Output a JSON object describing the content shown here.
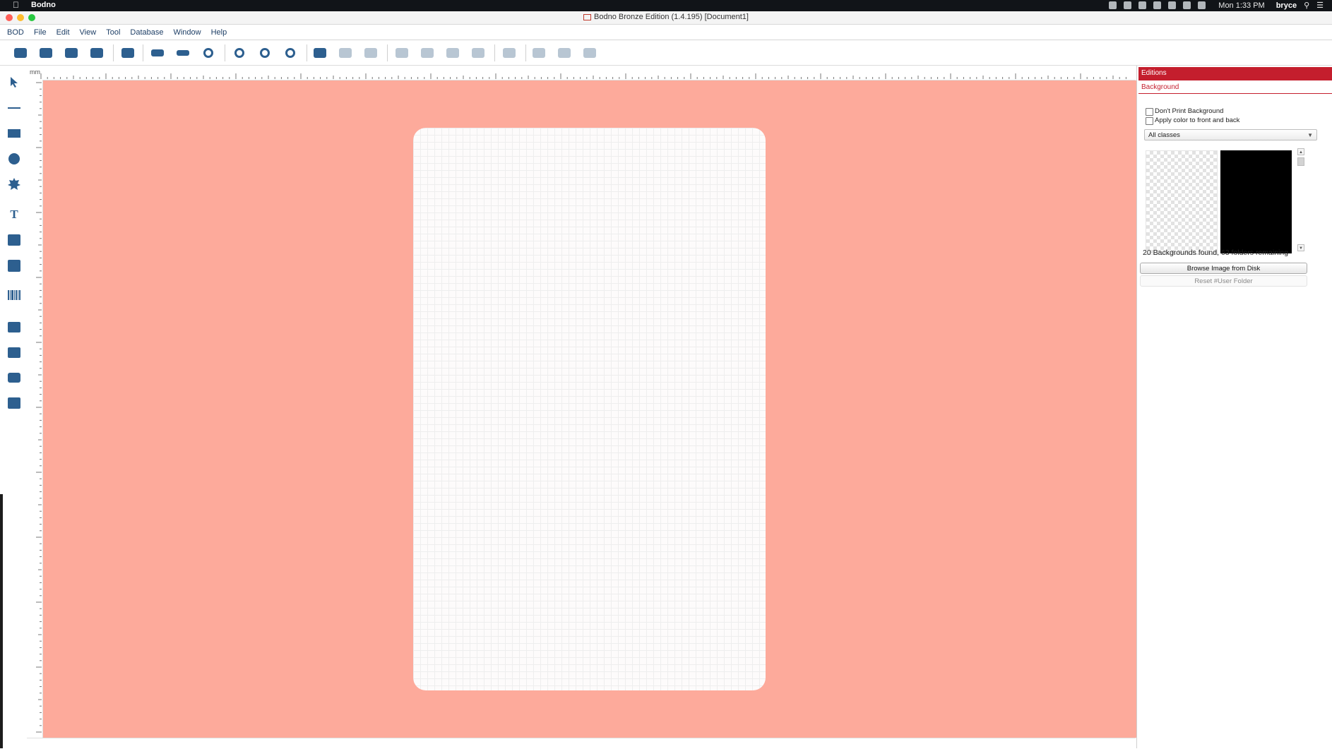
{
  "os_menubar": {
    "app_name": "Bodno",
    "clock": "Mon 1:33 PM",
    "user": "bryce"
  },
  "window": {
    "title": "Bodno Bronze Edition  (1.4.195) [Document1]"
  },
  "menu": {
    "items": [
      "BOD",
      "File",
      "Edit",
      "View",
      "Tool",
      "Database",
      "Window",
      "Help"
    ]
  },
  "toolbar": {
    "icons": [
      {
        "name": "new-document-icon"
      },
      {
        "name": "open-icon"
      },
      {
        "name": "save-icon"
      },
      {
        "name": "save-as-icon"
      },
      {
        "name": "print-icon"
      },
      {
        "name": "card-front-icon"
      },
      {
        "name": "card-back-icon"
      },
      {
        "name": "db-settings-icon"
      },
      {
        "name": "zoom-in-icon"
      },
      {
        "name": "zoom-out-icon"
      },
      {
        "name": "zoom-fit-icon"
      },
      {
        "name": "database-icon"
      },
      {
        "name": "db-first-icon"
      },
      {
        "name": "db-prev-icon"
      },
      {
        "name": "db-next-icon"
      },
      {
        "name": "db-last-icon"
      },
      {
        "name": "db-refresh-icon"
      },
      {
        "name": "db-add-icon"
      },
      {
        "name": "db-remove-icon"
      },
      {
        "name": "db-check-icon"
      }
    ]
  },
  "left_tools": [
    {
      "name": "select-arrow-icon"
    },
    {
      "name": "line-tool-icon"
    },
    {
      "name": "rectangle-tool-icon"
    },
    {
      "name": "ellipse-tool-icon"
    },
    {
      "name": "polygon-tool-icon"
    },
    {
      "name": "text-tool-icon"
    },
    {
      "name": "field-tool-icon"
    },
    {
      "name": "calendar-tool-icon"
    },
    {
      "name": "barcode-tool-icon"
    },
    {
      "name": "folder-image-tool-icon"
    },
    {
      "name": "image-tool-icon"
    },
    {
      "name": "camera-tool-icon"
    },
    {
      "name": "signature-tool-icon"
    }
  ],
  "ruler": {
    "unit": "mm"
  },
  "canvas": {
    "background_color": "#fdaa9b",
    "card_color": "#fdfbfb"
  },
  "panel": {
    "header": "Editions",
    "tab": "Background",
    "dont_print_label": "Don't Print Background",
    "apply_color_label": "Apply color to front and back",
    "class_select": "All classes",
    "found_text": "20 Backgrounds found, 63 folders remaining",
    "browse_button": "Browse Image from Disk",
    "reset_button": "Reset #User Folder",
    "accent": "#c41e2d"
  }
}
